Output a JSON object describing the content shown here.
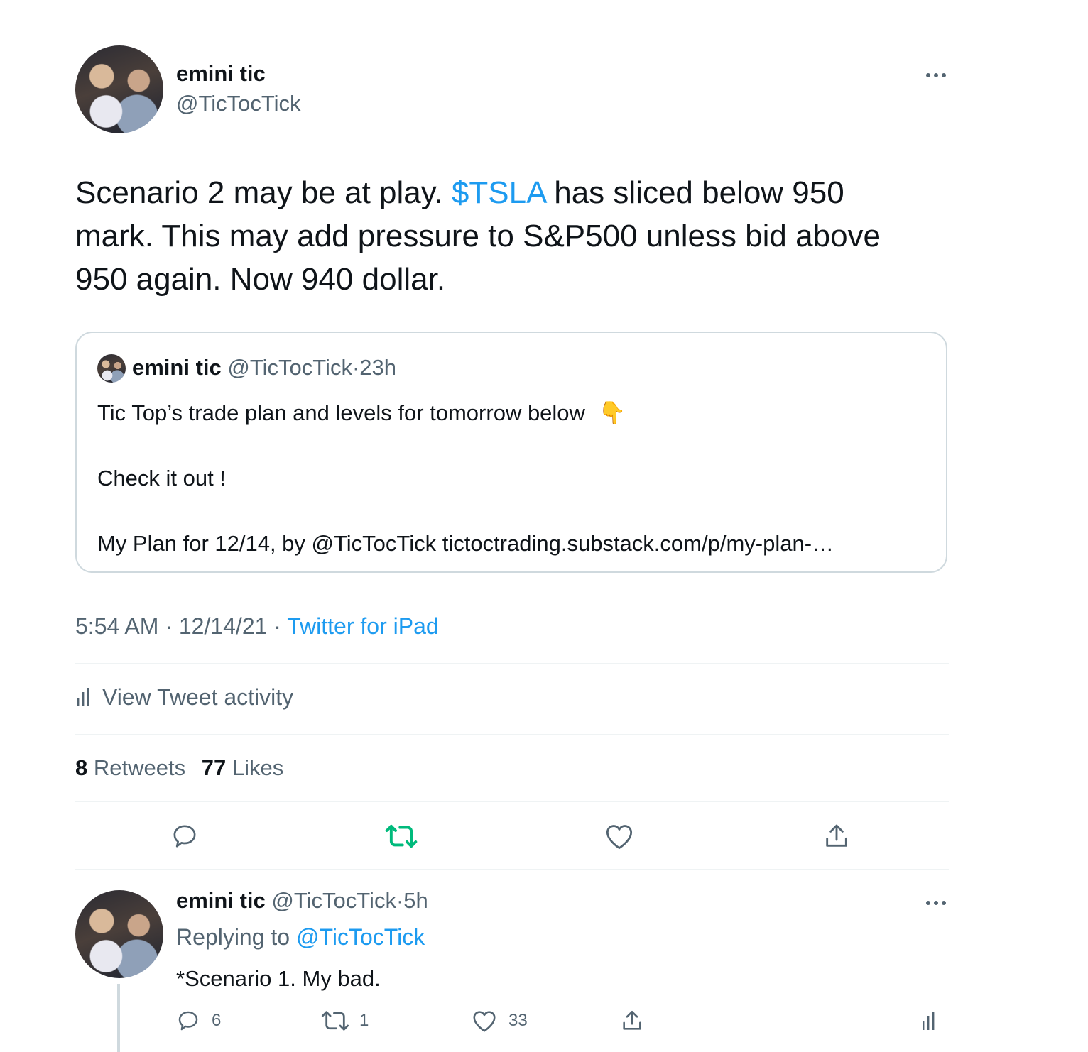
{
  "tweet": {
    "author_name": "emini tic",
    "author_handle": "@TicTocTick",
    "text_pre": "Scenario 2 may be at play. ",
    "cashtag": "$TSLA",
    "text_post_line1": " has sliced below 950",
    "text_line2": "mark. This may add pressure to S&P500 unless bid above",
    "text_line3": "950 again. Now 940 dollar.",
    "time": "5:54 AM",
    "sep1": " · ",
    "date": "12/14/21",
    "sep2": " · ",
    "source": "Twitter for iPad"
  },
  "quote": {
    "author_name": "emini tic",
    "author_handle": "@TicTocTick",
    "dot": "·",
    "age": "23h",
    "line1": "Tic Top’s trade plan and levels for tomorrow below",
    "emoji": "👇",
    "line2": "Check it out !",
    "line3": "My Plan for 12/14, by @TicTocTick tictoctrading.substack.com/p/my-plan-…"
  },
  "activity": {
    "label": "View Tweet activity"
  },
  "stats": {
    "retweets_count": "8",
    "retweets_label": "Retweets",
    "likes_count": "77",
    "likes_label": "Likes"
  },
  "reply": {
    "author_name": "emini tic",
    "author_handle": "@TicTocTick",
    "dot": "·",
    "age": "5h",
    "replying_prefix": "Replying to ",
    "replying_handle": "@TicTocTick",
    "text": "*Scenario 1. My bad.",
    "reply_count": "6",
    "retweet_count": "1",
    "like_count": "33"
  },
  "colors": {
    "accent": "#1d9bf0",
    "retweet_active": "#00ba7c",
    "muted": "#536471",
    "border": "#cfd9de"
  }
}
